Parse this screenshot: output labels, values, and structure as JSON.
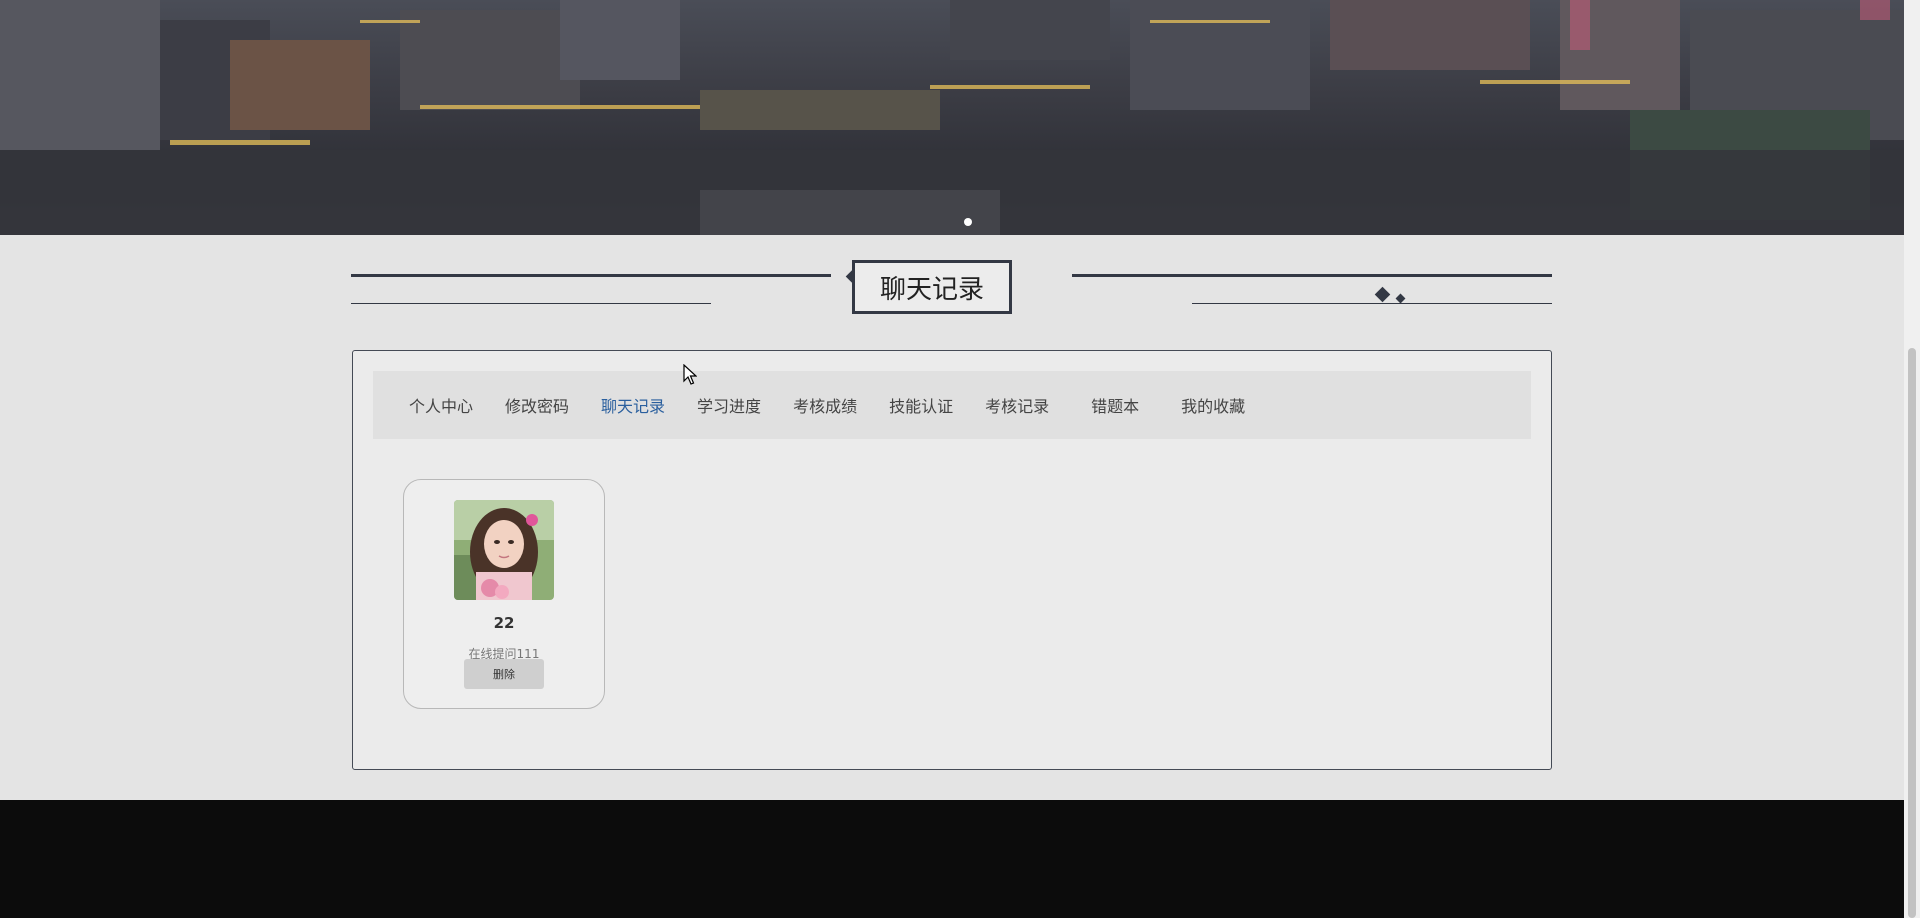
{
  "section": {
    "title": "聊天记录"
  },
  "tabs": [
    {
      "label": "个人中心"
    },
    {
      "label": "修改密码"
    },
    {
      "label": "聊天记录",
      "active": true
    },
    {
      "label": "学习进度"
    },
    {
      "label": "考核成绩"
    },
    {
      "label": "技能认证"
    },
    {
      "label": "考核记录"
    },
    {
      "label": "错题本"
    },
    {
      "label": "我的收藏"
    }
  ],
  "chat_card": {
    "name": "22",
    "subtitle": "在线提问111",
    "delete_label": "删除"
  },
  "banner": {
    "active_slide": 1
  },
  "colors": {
    "accent": "#2a5f9e",
    "dark_line": "#333844",
    "footer": "#0c0c0c",
    "page_bg": "#e4e4e4"
  },
  "icons": [
    "cursor-icon",
    "diamond-ornament-icon"
  ]
}
